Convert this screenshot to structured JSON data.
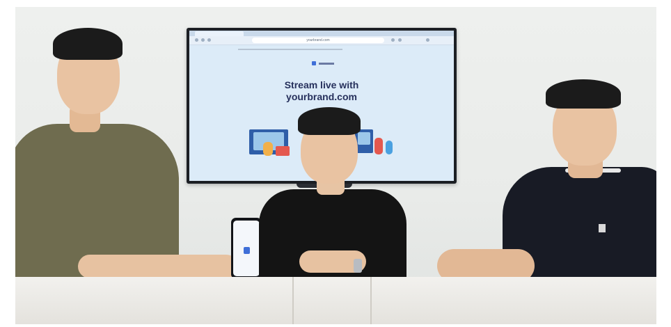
{
  "tv": {
    "browser_tab": "",
    "url": "yourbrand.com",
    "headline_line1": "Stream live with",
    "headline_line2": "yourbrand.com"
  },
  "colors": {
    "wall": "#eef0ee",
    "tv_screen": "#dcebf8",
    "headline": "#26305c",
    "brand_blue": "#3f6fd8",
    "olive_shirt": "#6f6c4f",
    "black_shirt": "#141414",
    "navy_shirt": "#181b25"
  }
}
